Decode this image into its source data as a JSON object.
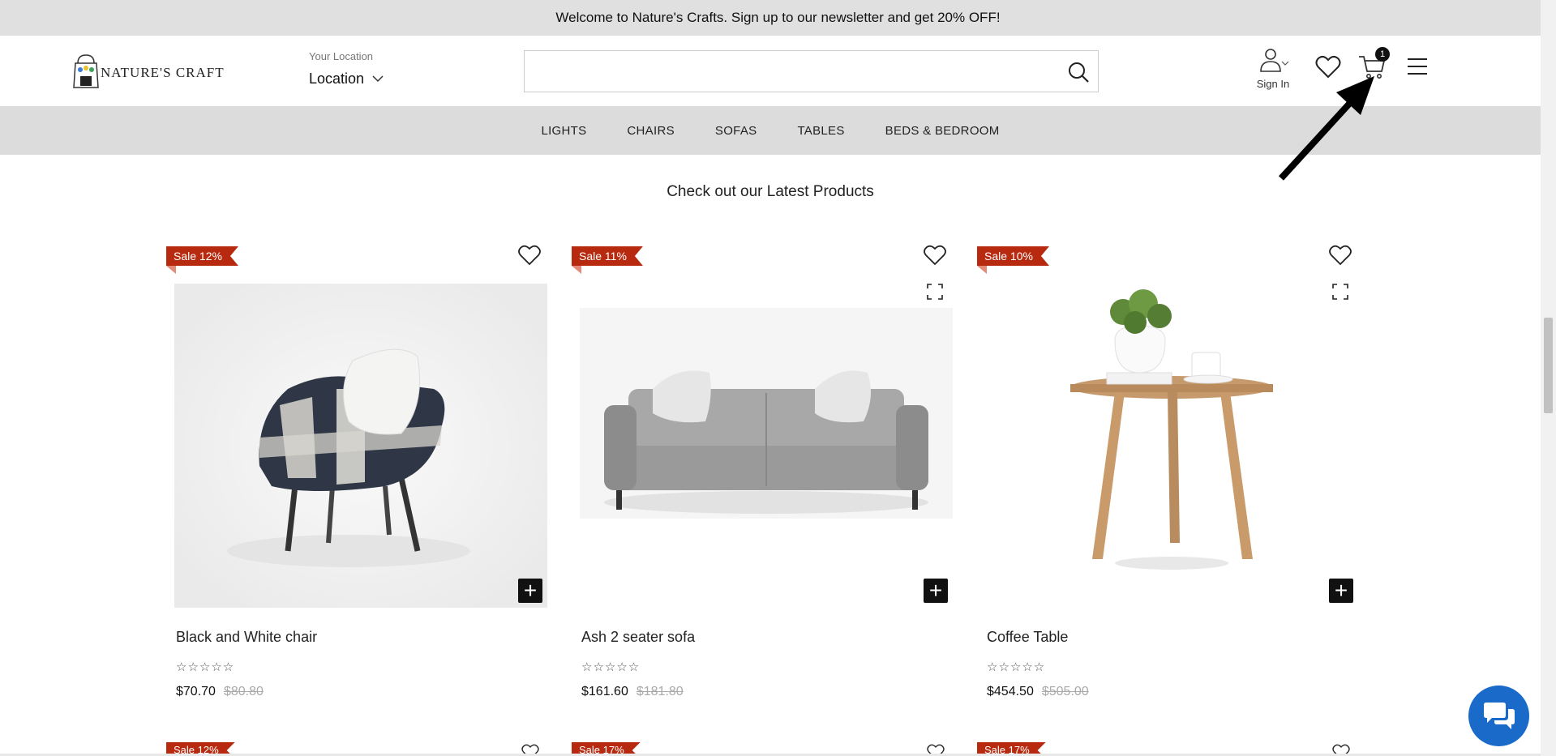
{
  "announcement": "Welcome to Nature's Crafts. Sign up to our newsletter and get 20% OFF!",
  "header": {
    "logo_text": "NATURE'S CRAFT",
    "location_label": "Your Location",
    "location_value": "Location",
    "search_placeholder": "",
    "sign_in": "Sign In",
    "cart_count": "1"
  },
  "nav": [
    "LIGHTS",
    "CHAIRS",
    "SOFAS",
    "TABLES",
    "BEDS & BEDROOM"
  ],
  "section_title": "Check out our Latest Products",
  "products": [
    {
      "sale": "Sale 12%",
      "name": "Black and White chair",
      "rating": "☆☆☆☆☆",
      "price": "$70.70",
      "old_price": "$80.80"
    },
    {
      "sale": "Sale 11%",
      "name": "Ash 2 seater sofa",
      "rating": "☆☆☆☆☆",
      "price": "$161.60",
      "old_price": "$181.80"
    },
    {
      "sale": "Sale 10%",
      "name": "Coffee Table",
      "rating": "☆☆☆☆☆",
      "price": "$454.50",
      "old_price": "$505.00"
    }
  ],
  "next_row_sales": [
    "Sale 12%",
    "Sale 17%",
    "Sale 17%"
  ],
  "colors": {
    "sale_badge": "#b72a0f",
    "chat": "#1a6ac9",
    "nav_bg": "#dcdcdc",
    "announce_bg": "#e0e0e0"
  },
  "icons": [
    "user-icon",
    "heart-icon",
    "cart-icon",
    "menu-icon",
    "search-icon",
    "expand-icon",
    "plus-icon",
    "chat-icon",
    "chevron-down-icon"
  ]
}
